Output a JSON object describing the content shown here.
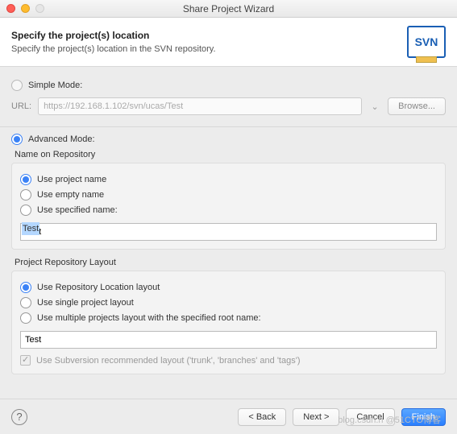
{
  "window": {
    "title": "Share Project Wizard"
  },
  "header": {
    "title": "Specify the project(s) location",
    "subtitle": "Specify the project(s) location in the SVN repository.",
    "logo_text": "SVN"
  },
  "simple": {
    "label": "Simple Mode:",
    "url_label": "URL:",
    "url_value": "https://192.168.1.102/svn/ucas/Test",
    "browse": "Browse..."
  },
  "advanced": {
    "label": "Advanced Mode:",
    "name_group": {
      "title": "Name on Repository",
      "use_project": "Use project name",
      "use_empty": "Use empty name",
      "use_specified": "Use specified name:",
      "specified_value": "Test"
    },
    "layout_group": {
      "title": "Project Repository Layout",
      "use_location": "Use Repository Location layout",
      "use_single": "Use single project layout",
      "use_multiple": "Use multiple projects layout with the specified root name:",
      "root_value": "Test",
      "recommended": "Use Subversion recommended layout ('trunk', 'branches' and 'tags')"
    }
  },
  "footer": {
    "back": "< Back",
    "next": "Next >",
    "cancel": "Cancel",
    "finish": "Finish"
  },
  "watermark": "blog.csdn.n @51CTO博客"
}
